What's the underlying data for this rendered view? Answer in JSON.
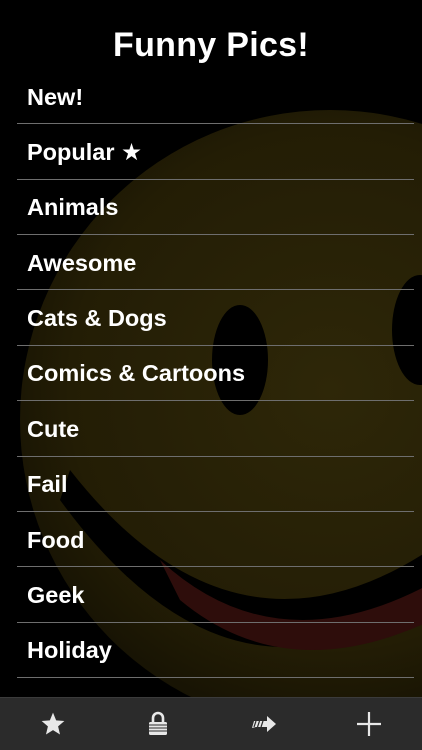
{
  "header": {
    "title": "Funny Pics!"
  },
  "menu": {
    "items": [
      {
        "label": "New!"
      },
      {
        "label": "Popular ★"
      },
      {
        "label": "Animals"
      },
      {
        "label": "Awesome"
      },
      {
        "label": "Cats & Dogs"
      },
      {
        "label": "Comics & Cartoons"
      },
      {
        "label": "Cute"
      },
      {
        "label": "Fail"
      },
      {
        "label": "Food"
      },
      {
        "label": "Geek"
      },
      {
        "label": "Holiday"
      }
    ]
  },
  "toolbar": {
    "buttons": [
      {
        "icon": "star-icon"
      },
      {
        "icon": "lock-icon"
      },
      {
        "icon": "share-arrow-icon"
      },
      {
        "icon": "plus-icon"
      }
    ]
  },
  "colors": {
    "background": "#000000",
    "smiley": "#2a2306",
    "smiley_mouth": "#2a0e0c",
    "toolbar": "#2b2b2b",
    "divider": "#6e6e6e",
    "text": "#ffffff"
  }
}
